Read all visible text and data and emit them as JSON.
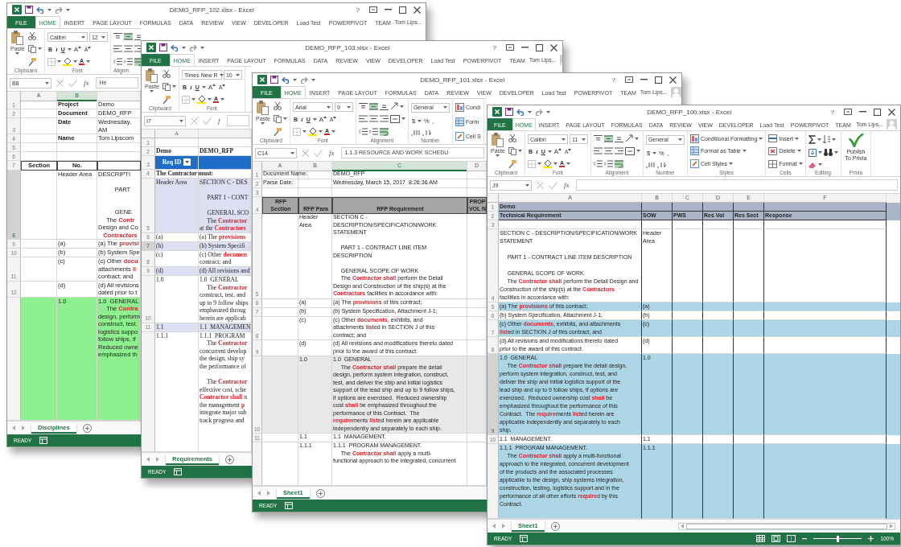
{
  "windows": [
    {
      "title": "DEMO_RFP_102.xlsx - Excel",
      "help": "?",
      "tabs": [
        {
          "label": "FILE",
          "kind": "file",
          "selected": false
        },
        {
          "label": "HOME",
          "kind": "tab",
          "selected": true
        },
        {
          "label": "INSERT",
          "kind": "tab",
          "selected": false
        },
        {
          "label": "PAGE LAYOUT",
          "kind": "tab",
          "selected": false
        },
        {
          "label": "FORMULAS",
          "kind": "tab",
          "selected": false
        },
        {
          "label": "DATA",
          "kind": "tab",
          "selected": false
        },
        {
          "label": "REVIEW",
          "kind": "tab",
          "selected": false
        },
        {
          "label": "VIEW",
          "kind": "tab",
          "selected": false
        },
        {
          "label": "DEVELOPER",
          "kind": "tab",
          "selected": false
        },
        {
          "label": "Load Test",
          "kind": "tab",
          "selected": false
        },
        {
          "label": "POWERPIVOT",
          "kind": "tab",
          "selected": false
        },
        {
          "label": "TEAM",
          "kind": "tab",
          "selected": false
        }
      ],
      "user": "Tom Lips...",
      "ribbon": [
        {
          "kind": "clipboard",
          "label": "Clipboard",
          "paste": "Paste"
        },
        {
          "kind": "font",
          "label": "Font",
          "font": "Calibri",
          "size": "12",
          "format": [
            "B",
            "I",
            "U"
          ],
          "sizing": [
            "A",
            "A"
          ],
          "font_color_label": "A"
        },
        {
          "kind": "alignment",
          "label": "Alignm"
        }
      ],
      "name_box": "B8",
      "fx": "fx",
      "formula": "He",
      "columns": [
        {
          "label": "A",
          "selected": false
        },
        {
          "label": "B",
          "selected": true
        },
        {
          "selected": false
        }
      ],
      "rows": [
        {
          "num": "1",
          "kind": "label",
          "selected": false,
          "cells": [
            null,
            "Project",
            "Demo"
          ]
        },
        {
          "num": "2",
          "kind": "label",
          "selected": false,
          "cells": [
            null,
            "Document",
            "DEMO_RFP"
          ]
        },
        {
          "num": "3",
          "kind": "label",
          "selected": false,
          "cells": [
            null,
            "Date",
            "Wednesday,\nAM"
          ]
        },
        {
          "num": "4",
          "kind": "label",
          "selected": false,
          "cells": [
            null,
            "Name",
            "Tom Lipscom"
          ]
        },
        {
          "num": "5",
          "kind": "plain",
          "selected": false,
          "cells": [
            null,
            null,
            null
          ]
        },
        {
          "num": "6",
          "kind": "plain",
          "selected": false,
          "cells": [
            null,
            null,
            null
          ]
        },
        {
          "num": "7",
          "kind": "header",
          "selected": false,
          "cells": [
            "Section",
            "No.",
            null
          ]
        },
        {
          "num": "8",
          "kind": "plain",
          "selected": true,
          "cells": [
            null,
            "Header Area",
            "DESCRIPTI\n\n          PART\n\n\n          GENE\n     The **Contr**\nDesign and Co\n   **Contractors**"
          ]
        },
        {
          "num": "9",
          "kind": "plain",
          "selected": false,
          "cells": [
            null,
            "(a)",
            "(a) The **provisi**"
          ]
        },
        {
          "num": "10",
          "kind": "plain",
          "selected": false,
          "cells": [
            null,
            "(b)",
            "(b) System Spe"
          ]
        },
        {
          "num": "11",
          "kind": "plain",
          "selected": false,
          "cells": [
            null,
            "(c)",
            "(c) Other **docu**\nattachments **li**\ncontract; and"
          ]
        },
        {
          "num": "12",
          "kind": "plain",
          "selected": false,
          "cells": [
            null,
            "(d)",
            "(d) All revisions\ndated prior to t"
          ]
        },
        {
          "kind": "plain",
          "selected": false,
          "color": "#8ef08e",
          "cells": [
            null,
            "1.0",
            "1.0  GENERAL\n     The **Contra**\ndesign, perform\nconstruct, test,\nlogistics suppo\nfollow ships, if\nReduced owne\nemphasized th"
          ]
        }
      ],
      "sheet": "Disciplines",
      "status": {
        "label": "READY"
      }
    },
    {
      "title": "DEMO_RFP_103.xlsx - Excel",
      "help": "?",
      "tabs": [
        {
          "label": "FILE",
          "kind": "file",
          "selected": false
        },
        {
          "label": "HOME",
          "kind": "tab",
          "selected": true
        },
        {
          "label": "INSERT",
          "kind": "tab",
          "selected": false
        },
        {
          "label": "PAGE LAYOUT",
          "kind": "tab",
          "selected": false
        },
        {
          "label": "FORMULAS",
          "kind": "tab",
          "selected": false
        },
        {
          "label": "DATA",
          "kind": "tab",
          "selected": false
        },
        {
          "label": "REVIEW",
          "kind": "tab",
          "selected": false
        },
        {
          "label": "VIEW",
          "kind": "tab",
          "selected": false
        },
        {
          "label": "DEVELOPER",
          "kind": "tab",
          "selected": false
        },
        {
          "label": "Load Test",
          "kind": "tab",
          "selected": false
        },
        {
          "label": "POWERPIVOT",
          "kind": "tab",
          "selected": false
        },
        {
          "label": "TEAM",
          "kind": "tab",
          "selected": false
        }
      ],
      "user": "Tom Lips...",
      "ribbon": [
        {
          "kind": "clipboard",
          "label": "Clipboard",
          "paste": "Paste"
        },
        {
          "kind": "font",
          "label": "Font",
          "font": "Times New R",
          "size": "10",
          "format": [
            "B",
            "I",
            "U"
          ],
          "sizing": [
            "A",
            "A"
          ],
          "font_color_label": "A"
        }
      ],
      "name_box": "I7",
      "fx": "f",
      "columns": [
        {
          "label": "A",
          "selected": false
        },
        {
          "selected": false
        }
      ],
      "rows": [
        {
          "num": "1",
          "kind": "plain",
          "selected": false,
          "cells": [
            null,
            null
          ]
        },
        {
          "num": "2",
          "kind": "bold",
          "selected": false,
          "cells": [
            "Demo",
            "DEMO_RFP"
          ]
        },
        {
          "num": "3",
          "kind": "blue",
          "selected": false,
          "color": "#1e6ec8",
          "cells": [
            "Req ID",
            null
          ]
        },
        {
          "num": "4",
          "kind": "bold",
          "selected": false,
          "cells": [
            "The Contractor must:",
            null
          ]
        },
        {
          "num": "5",
          "kind": "plain",
          "selected": false,
          "color": "#dde0f3",
          "cells": [
            "Header Area",
            "SECTION C - DES\n\n     PART 1 - CONT\n\n     GENERAL SCO\n     The **Contractor**\nat the **Contractors**"
          ]
        },
        {
          "num": "6",
          "kind": "plain",
          "selected": false,
          "cells": [
            "(a)",
            "(a) The **provisions**"
          ]
        },
        {
          "num": "7",
          "kind": "plain",
          "selected": true,
          "color": "#dde0f3",
          "cells": [
            "(b)",
            "(b) System Specifi"
          ]
        },
        {
          "num": "8",
          "kind": "plain",
          "selected": false,
          "cells": [
            "(c)",
            "(c) Other **documen**\ncontract; and"
          ]
        },
        {
          "num": "9",
          "kind": "plain",
          "selected": false,
          "color": "#dde0f3",
          "cells": [
            "(d)",
            "(d) All revisions and"
          ]
        },
        {
          "num": "10",
          "kind": "plain",
          "selected": false,
          "cells": [
            "1.0",
            "1.0  GENERAL\n     The **Contractor**\nconstruct, test, and\nup to 9 follow ships\nemphasized throug\nherein are applicab"
          ]
        },
        {
          "num": "11",
          "kind": "plain",
          "selected": false,
          "color": "#dde0f3",
          "cells": [
            "1.1",
            "1.1  MANAGEMEN"
          ]
        },
        {
          "kind": "plain",
          "selected": false,
          "cells": [
            "1.1.1",
            "1.1.1  PROGRAM\n     The **Contractor**\nconcurrent develop\nthe design, ship sy\nthe performance of\n\n     The **Contractor**\neffective cost, sche\n**Contractor shall** n\nthe management **p**\nintegrate major sub\ntrack progress and"
          ]
        }
      ],
      "sheet": "Requirements",
      "status": {
        "label": "READY"
      }
    },
    {
      "title": "DEMO_RFP_101.xlsx - Excel",
      "help": "?",
      "tabs": [
        {
          "label": "FILE",
          "kind": "file",
          "selected": false
        },
        {
          "label": "HOME",
          "kind": "tab",
          "selected": true
        },
        {
          "label": "INSERT",
          "kind": "tab",
          "selected": false
        },
        {
          "label": "PAGE LAYOUT",
          "kind": "tab",
          "selected": false
        },
        {
          "label": "FORMULAS",
          "kind": "tab",
          "selected": false
        },
        {
          "label": "DATA",
          "kind": "tab",
          "selected": false
        },
        {
          "label": "REVIEW",
          "kind": "tab",
          "selected": false
        },
        {
          "label": "VIEW",
          "kind": "tab",
          "selected": false
        },
        {
          "label": "DEVELOPER",
          "kind": "tab",
          "selected": false
        },
        {
          "label": "Load Test",
          "kind": "tab",
          "selected": false
        },
        {
          "label": "POWERPIVOT",
          "kind": "tab",
          "selected": false
        },
        {
          "label": "TEAM",
          "kind": "tab",
          "selected": false
        }
      ],
      "user": "Tom Lips...",
      "ribbon": [
        {
          "kind": "clipboard",
          "label": "Clipboard",
          "paste": "Paste"
        },
        {
          "kind": "font",
          "label": "Font",
          "font": "Arial",
          "size": "9",
          "format": [
            "B",
            "I",
            "U"
          ],
          "sizing": [
            "A",
            "A"
          ],
          "font_color_label": "A"
        },
        {
          "kind": "alignment",
          "label": "Alignment"
        },
        {
          "kind": "number",
          "label": "Number",
          "format": "General",
          "symbols": [
            "$",
            "%",
            ","
          ]
        },
        {
          "kind": "styles",
          "items": [
            "Condi",
            "Form",
            "Cell S"
          ]
        }
      ],
      "name_box": "C14",
      "fx": "fx",
      "formula": "1.1.3  RESOURCE AND WORK SCHEDU",
      "columns": [
        {
          "label": "A",
          "selected": false
        },
        {
          "label": "B",
          "selected": false
        },
        {
          "label": "C",
          "selected": true
        },
        {
          "label": "D",
          "selected": false
        }
      ],
      "rows": [
        {
          "num": "1",
          "kind": "plain",
          "selected": false,
          "cells": [
            "Document Name:",
            null,
            "DEMO_RFP",
            null
          ]
        },
        {
          "num": "2",
          "kind": "plain",
          "selected": false,
          "cells": [
            "Parse Date:",
            null,
            "Wednesday, March 15, 2017  8:26:36 AM",
            null
          ]
        },
        {
          "num": "3",
          "kind": "plain",
          "selected": false,
          "cells": [
            null,
            null,
            null,
            null
          ]
        },
        {
          "num": "4",
          "kind": "header",
          "selected": false,
          "color": "#a6a6a6",
          "cells": [
            "RFP\nSection",
            "RFP Para",
            "RFP Requirement",
            "PROP\nVOL N"
          ]
        },
        {
          "num": "5",
          "kind": "plain",
          "selected": false,
          "cells": [
            null,
            "Header\nArea",
            "SECTION C -\nDESCRIPTION/SPECIFICATION/WORK\nSTATEMENT\n\n     PART 1 - CONTRACT LINE ITEM\nDESCRIPTION\n\n     GENERAL SCOPE OF WORK\n     The **Contractor shall** perform the Detail\nDesign and Construction of the ship(s) at the\n**Contractors** facilities in accordance with:",
            null
          ]
        },
        {
          "num": "6",
          "kind": "plain",
          "selected": false,
          "cells": [
            null,
            "(a)",
            "(a) The **provisions** of this contract;",
            null
          ]
        },
        {
          "num": "7",
          "kind": "plain",
          "selected": false,
          "cells": [
            null,
            "(b)",
            "(b) System Specification, Attachment J-1;",
            null
          ]
        },
        {
          "num": "8",
          "kind": "plain",
          "selected": false,
          "cells": [
            null,
            "(c)",
            "(c) Other **documents**, exhibits, and\nattachments **list**ed in SECTION J of this\ncontract; and",
            null
          ]
        },
        {
          "num": "9",
          "kind": "plain",
          "selected": false,
          "cells": [
            null,
            "(d)",
            "(d) All revisions and modifications thereto dated\nprior to the award of this contract.",
            null
          ]
        },
        {
          "num": "10",
          "kind": "plain",
          "selected": false,
          "color": "#e8e8e8",
          "cells": [
            null,
            "1.0",
            "1.0  GENERAL\n     The **Contractor shall** prepare the detail\ndesign, perform system integration, construct,\ntest, and deliver the ship and initial logistics\nsupport of the lead ship and up to 9 follow ships,\nif options are exercised.  Reduced ownership\ncost **shall** be emphasized throughout the\nperformance of this Contract.  The\n**require**ments **list**ed herein are applicable\nindependently and separately to each ship.",
            null
          ]
        },
        {
          "num": "11",
          "kind": "plain",
          "selected": false,
          "cells": [
            null,
            "1.1",
            "1.1  MANAGEMENT.",
            null
          ]
        },
        {
          "kind": "plain",
          "selected": false,
          "cells": [
            null,
            "1.1.1",
            "1.1.1  PROGRAM MANAGEMENT.\n     The **Contractor shall** apply a multi-\nfunctional approach to the integrated, concurrent",
            null
          ]
        }
      ],
      "sheet": "Sheet1",
      "status": {
        "label": "READY"
      }
    },
    {
      "title": "DEMO_RFP_100.xlsx - Excel",
      "help": "?",
      "tabs": [
        {
          "label": "FILE",
          "kind": "file",
          "selected": false
        },
        {
          "label": "HOME",
          "kind": "tab",
          "selected": true
        },
        {
          "label": "INSERT",
          "kind": "tab",
          "selected": false
        },
        {
          "label": "PAGE LAYOUT",
          "kind": "tab",
          "selected": false
        },
        {
          "label": "FORMULAS",
          "kind": "tab",
          "selected": false
        },
        {
          "label": "DATA",
          "kind": "tab",
          "selected": false
        },
        {
          "label": "REVIEW",
          "kind": "tab",
          "selected": false
        },
        {
          "label": "VIEW",
          "kind": "tab",
          "selected": false
        },
        {
          "label": "DEVELOPER",
          "kind": "tab",
          "selected": false
        },
        {
          "label": "Load Test",
          "kind": "tab",
          "selected": false
        },
        {
          "label": "POWERPIVOT",
          "kind": "tab",
          "selected": false
        },
        {
          "label": "TEAM",
          "kind": "tab",
          "selected": false
        }
      ],
      "user": "Tom Lips...",
      "ribbon": [
        {
          "kind": "clipboard",
          "label": "Clipboard",
          "paste": "Paste"
        },
        {
          "kind": "font",
          "label": "Font",
          "font": "Calibri",
          "size": "11",
          "format": [
            "B",
            "I",
            "U"
          ],
          "sizing": [
            "A",
            "A"
          ],
          "font_color_label": "A"
        },
        {
          "kind": "alignment",
          "label": "Alignment"
        },
        {
          "kind": "number",
          "label": "Number",
          "format": "General",
          "symbols": [
            "$",
            "%",
            ","
          ]
        },
        {
          "kind": "styles",
          "label": "Styles",
          "items": [
            "Conditional Formatting",
            "Format as Table",
            "Cell Styles"
          ]
        },
        {
          "kind": "cells",
          "label": "Cells",
          "items": [
            "Insert",
            "Delete",
            "Format"
          ]
        },
        {
          "kind": "editing",
          "label": "Editing"
        },
        {
          "kind": "privia",
          "label": "Privia",
          "button": "Publish\nTo Privia"
        }
      ],
      "name_box": "J9",
      "fx": "fx",
      "columns": [
        {
          "label": "A",
          "selected": false
        },
        {
          "label": "B",
          "selected": false
        },
        {
          "label": "C",
          "selected": false
        },
        {
          "label": "D",
          "selected": false
        },
        {
          "label": "E",
          "selected": false
        },
        {
          "label": "F",
          "selected": false
        }
      ],
      "rows": [
        {
          "num": "1",
          "kind": "band",
          "selected": false,
          "color": "#aab6c8",
          "cells": [
            "Demo",
            null,
            null,
            null,
            null,
            null
          ]
        },
        {
          "num": "2",
          "kind": "band",
          "selected": false,
          "color": "#aab6c8",
          "cells": [
            "Technical Requirement",
            "SOW",
            "PWS",
            "Res Vol",
            "Res Sect",
            "Response"
          ]
        },
        {
          "num": "3",
          "kind": "plain",
          "selected": false,
          "cells": [
            null,
            null,
            null,
            null,
            null,
            null
          ]
        },
        {
          "num": "4",
          "kind": "plain",
          "selected": false,
          "cells": [
            "SECTION C - DESCRIPTION/SPECIFICATION/WORK\nSTATEMENT\n\n     PART 1 - CONTRACT LINE ITEM DESCRIPTION\n\n     GENERAL SCOPE OF WORK\n     The **Contractor shall** perform the Detail Design and\nConstruction of the ship(s) at the **Contractors**\nfacilities in accordance with:",
            "Header\nArea",
            null,
            null,
            null,
            null
          ]
        },
        {
          "num": "5",
          "kind": "plain",
          "selected": false,
          "color": "#acd5e5",
          "cells": [
            "(a) The **provisions** of this contract;",
            "(a)",
            null,
            null,
            null,
            null
          ]
        },
        {
          "num": "6",
          "kind": "plain",
          "selected": false,
          "cells": [
            "(b) System Specification, Attachment J-1;",
            "(b)",
            null,
            null,
            null,
            null
          ]
        },
        {
          "num": "7",
          "kind": "plain",
          "selected": false,
          "color": "#acd5e5",
          "cells": [
            "(c) Other **documents**, exhibits, and attachments\n**list**ed in SECTION J of this contract; and",
            "(c)",
            null,
            null,
            null,
            null
          ]
        },
        {
          "num": "8",
          "kind": "plain",
          "selected": false,
          "cells": [
            "(d) All revisions and modifications thereto dated\nprior to the award of this contract.",
            "(d)",
            null,
            null,
            null,
            null
          ]
        },
        {
          "num": "9",
          "kind": "plain",
          "selected": true,
          "color": "#acd5e5",
          "cells": [
            "1.0  GENERAL\n     The **Contractor shall** prepare the detail design,\nperform system integration, construct, test, and\ndeliver the ship and initial logistics support of the\nlead ship and up to 9 follow ships, if options are\nexercised.  Reduced ownership cost **shall** be\nemphasized throughout the performance of this\nContract.  The **require**ments **list**ed herein are\napplicable independently and separately to each\nship.",
            "1.0",
            null,
            null,
            null,
            null
          ]
        },
        {
          "num": "10",
          "kind": "plain",
          "selected": false,
          "cells": [
            "1.1  MANAGEMENT.",
            "1.1",
            null,
            null,
            null,
            null
          ]
        },
        {
          "kind": "plain",
          "selected": false,
          "color": "#acd5e5",
          "cells": [
            "1.1.1  PROGRAM MANAGEMENT.\n     The **Contractor shall** apply a multi-functional\napproach to the integrated, concurrent development\nof the products and the associated processes\napplicable to the design, ship systems integration,\nconstruction, testing, logistics support and in the\nperformance of all other efforts **require**d by this\nContract.",
            "1.1.1",
            null,
            null,
            null,
            null
          ]
        }
      ],
      "sheet": "Sheet1",
      "status": {
        "label": "READY",
        "zoom": {
          "label": "100%",
          "level": 0.5
        }
      }
    }
  ]
}
